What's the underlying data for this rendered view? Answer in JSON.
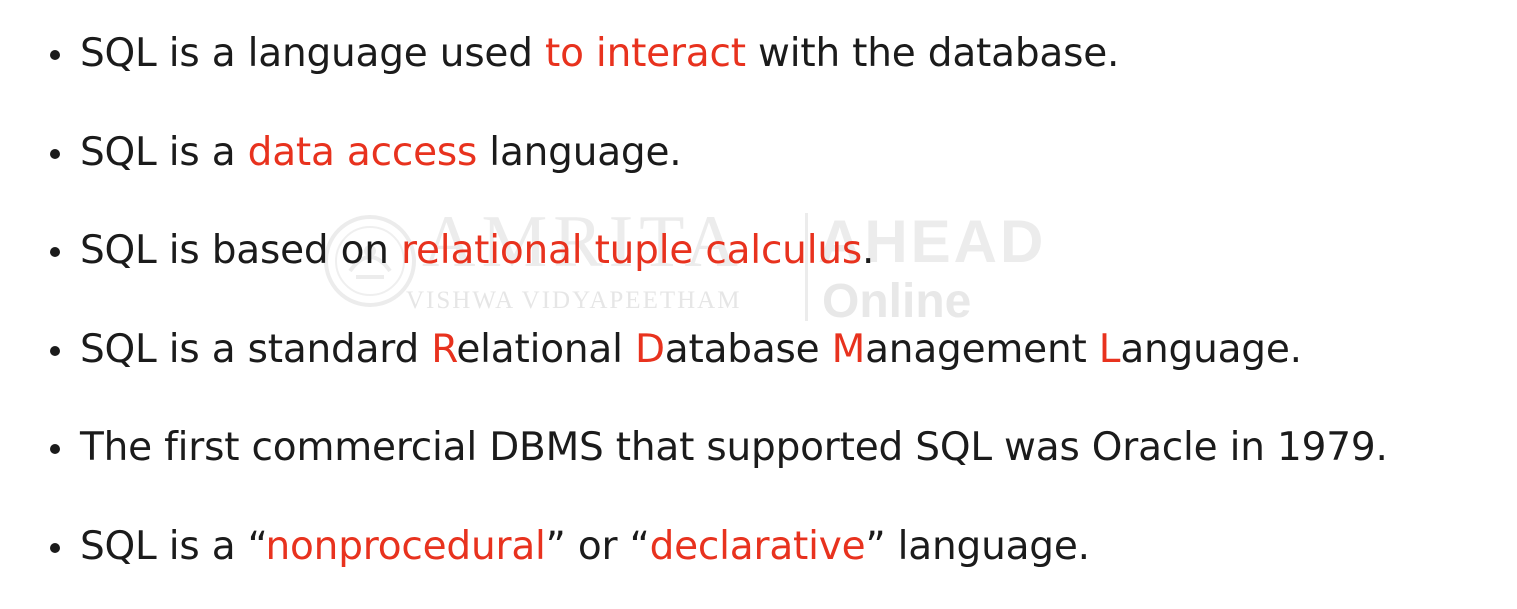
{
  "watermark": {
    "brand": "AMRITA",
    "subtitle": "VISHWA VIDYAPEETHAM",
    "ahead": "AHEAD",
    "online": "Online"
  },
  "bullets": [
    {
      "segments": [
        {
          "text": "SQL is a language used ",
          "highlight": false
        },
        {
          "text": "to interact",
          "highlight": true
        },
        {
          "text": " with the database.",
          "highlight": false
        }
      ]
    },
    {
      "segments": [
        {
          "text": "SQL is a ",
          "highlight": false
        },
        {
          "text": "data access",
          "highlight": true
        },
        {
          "text": " language.",
          "highlight": false
        }
      ]
    },
    {
      "segments": [
        {
          "text": "SQL is based on ",
          "highlight": false
        },
        {
          "text": "relational tuple calculus",
          "highlight": true
        },
        {
          "text": ".",
          "highlight": false
        }
      ]
    },
    {
      "segments": [
        {
          "text": "SQL is a standard ",
          "highlight": false
        },
        {
          "text": "R",
          "highlight": true
        },
        {
          "text": "elational ",
          "highlight": false
        },
        {
          "text": "D",
          "highlight": true
        },
        {
          "text": "atabase ",
          "highlight": false
        },
        {
          "text": "M",
          "highlight": true
        },
        {
          "text": "anagement ",
          "highlight": false
        },
        {
          "text": "L",
          "highlight": true
        },
        {
          "text": "anguage.",
          "highlight": false
        }
      ]
    },
    {
      "segments": [
        {
          "text": "The first commercial DBMS that supported SQL was Oracle in 1979.",
          "highlight": false
        }
      ]
    },
    {
      "segments": [
        {
          "text": "SQL is a “",
          "highlight": false
        },
        {
          "text": "nonprocedural",
          "highlight": true
        },
        {
          "text": "” or “",
          "highlight": false
        },
        {
          "text": "declarative",
          "highlight": true
        },
        {
          "text": "” language.",
          "highlight": false
        }
      ]
    }
  ],
  "colors": {
    "text": "#1b1b1b",
    "highlight": "#e8321e",
    "background": "#ffffff",
    "watermark": "#ececec"
  }
}
